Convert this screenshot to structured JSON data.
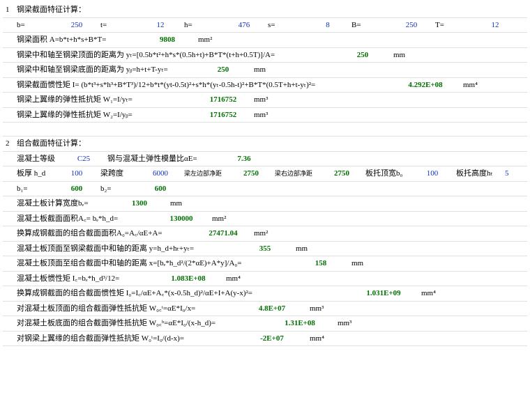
{
  "sec1": {
    "idx": "1",
    "title": "钢梁截面特征计算：",
    "params": {
      "b_lbl": "b=",
      "b": "250",
      "t_lbl": "t=",
      "t": "12",
      "h_lbl": "h=",
      "h": "476",
      "s_lbl": "s=",
      "s": "8",
      "B_lbl": "B=",
      "B": "250",
      "T_lbl": "T=",
      "T": "12"
    },
    "area": {
      "lbl": "钢梁面积 A=b*t+h*s+B*T=",
      "val": "9808",
      "unit": "mm²"
    },
    "yt": {
      "lbl": "钢梁中和轴至钢梁顶面的距离为 yₜ=[0.5b*t²+h*s*(0.5h+t)+B*T*(t+h+0.5T)]/A=",
      "val": "250",
      "unit": "mm"
    },
    "yb": {
      "lbl": "钢梁中和轴至钢梁底面的距离为 yᵦ=h+t+T-yₜ=",
      "val": "250",
      "unit": "mm"
    },
    "I": {
      "lbl": "钢梁截面惯性矩 I= (b*t³+s*h³+B*T³)/12+b*t*(yt-0.5t)²+s*h*(yₜ-0.5h-t)²+B*T*(0.5T+h+t-yₜ)²=",
      "val": "4.292E+08",
      "unit": "mm⁴"
    },
    "W1": {
      "lbl": "钢梁上翼缘的弹性抵抗矩 W₁=I/yₜ=",
      "val": "1716752",
      "unit": "mm³"
    },
    "W2": {
      "lbl": "钢梁上翼缘的弹性抵抗矩 W₂=I/yᵦ=",
      "val": "1716752",
      "unit": "mm³"
    }
  },
  "sec2": {
    "idx": "2",
    "title": "组合截面特征计算：",
    "conc": {
      "grade_lbl": "混凝土等级",
      "grade": "C25",
      "aE_lbl": "钢与混凝土弹性模量比αE=",
      "aE": "7.36"
    },
    "row2": {
      "hd_lbl": "板厚 h_d",
      "hd": "100",
      "span_lbl": "梁跨度",
      "span": "6000",
      "left_lbl": "梁左边部净距",
      "left": "2750",
      "right_lbl": "梁右边部净距",
      "right": "2750",
      "b0_lbl": "板托顶宽b₀",
      "b0": "100",
      "ht_lbl": "板托高度hₜ",
      "ht": "5"
    },
    "row3": {
      "b1_lbl": "b₁=",
      "b1": "600",
      "b2_lbl": "b₂=",
      "b2": "600"
    },
    "be": {
      "lbl": "混凝土板计算宽度bₑ=",
      "val": "1300",
      "unit": "mm"
    },
    "Ac": {
      "lbl": "混凝土板截面面积A꜀= bₑ*h_d=",
      "val": "130000",
      "unit": "mm²"
    },
    "A0": {
      "lbl": "换算成钢截面的组合截面面积A₀=A꜀/αE+A=",
      "val": "27471.04",
      "unit": "mm²"
    },
    "y": {
      "lbl": "混凝土板顶面至钢梁截面中和轴的距离 y=h_d+hₜ+yₜ=",
      "val": "355",
      "unit": "mm"
    },
    "x": {
      "lbl": "混凝土板顶面至组合截面中和轴的距离 x=[bₑ*h_d²/(2*αE)+A*y]/A₀=",
      "val": "158",
      "unit": "mm"
    },
    "Ic": {
      "lbl": "混凝土板惯性矩 I꜀=bₑ*h_d³/12=",
      "val": "1.083E+08",
      "unit": "mm⁴"
    },
    "I0": {
      "lbl": "换算成钢截面的组合截面惯性矩 I₀=I꜀/αE+A꜀*(x-0.5h_d)²/αE+I+A(y-x)²=",
      "val": "1.031E+09",
      "unit": "mm⁴"
    },
    "W0ct": {
      "lbl": "对混凝土板顶面的组合截面弹性抵抗矩 W₀꜀ᵗ=αE*I₀/x=",
      "val": "4.8E+07",
      "unit": "mm³"
    },
    "W0cb": {
      "lbl": "对混凝土板底面的组合截面弹性抵抗矩 W₀꜀ᵇ=αE*I₀/(x-h_d)=",
      "val": "1.31E+08",
      "unit": "mm³"
    },
    "W0": {
      "lbl": "对钢梁上翼缘的组合截面弹性抵抗矩 W₀ᵗ=I₀/(d-x)=",
      "val": "-2E+07",
      "unit": "mm⁴"
    }
  }
}
